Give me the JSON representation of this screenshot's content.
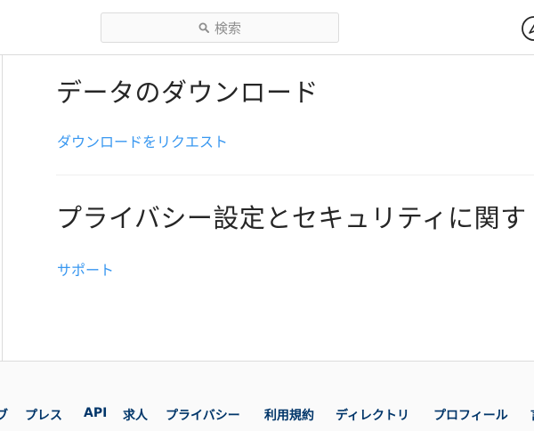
{
  "header": {
    "search": {
      "placeholder": "検索"
    },
    "activity_icon": "activity-icon"
  },
  "sections": [
    {
      "title": "データのダウンロード",
      "link": "ダウンロードをリクエスト"
    },
    {
      "title": "プライバシー設定とセキュリティに関す",
      "link": "サポート"
    }
  ],
  "footer": {
    "links": [
      "ブ",
      "プレス",
      "API",
      "求人",
      "プライバシー",
      "利用規約",
      "ディレクトリ",
      "プロフィール",
      "言"
    ]
  },
  "colors": {
    "link": "#3897f0",
    "footer_link": "#003569",
    "border": "#dbdbdb",
    "text": "#262626"
  }
}
